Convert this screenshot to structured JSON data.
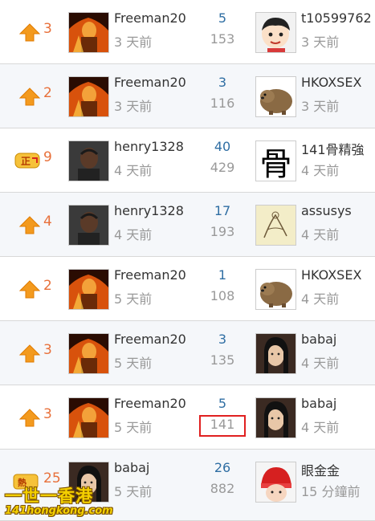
{
  "rows": [
    {
      "badge": "up-arrow-icon",
      "score": "3",
      "author": "Freeman20",
      "author_avatar": "freeman",
      "time": "3 天前",
      "replies": "5",
      "views": "153",
      "last_user": "t10599762",
      "last_avatar": "cartoon",
      "last_time": "3 天前"
    },
    {
      "badge": "up-arrow-icon",
      "score": "2",
      "author": "Freeman20",
      "author_avatar": "freeman",
      "time": "3 天前",
      "replies": "3",
      "views": "116",
      "last_user": "HKOXSEX",
      "last_avatar": "wombat",
      "last_time": "3 天前"
    },
    {
      "badge": "positive-badge-icon",
      "score": "9",
      "author": "henry1328",
      "author_avatar": "henry",
      "time": "4 天前",
      "replies": "40",
      "views": "429",
      "last_user": "141骨精強",
      "last_avatar": "bone-char",
      "last_time": "4 天前"
    },
    {
      "badge": "up-arrow-icon",
      "score": "4",
      "author": "henry1328",
      "author_avatar": "henry",
      "time": "4 天前",
      "replies": "17",
      "views": "193",
      "last_user": "assusys",
      "last_avatar": "sketch",
      "last_time": "4 天前"
    },
    {
      "badge": "up-arrow-icon",
      "score": "2",
      "author": "Freeman20",
      "author_avatar": "freeman",
      "time": "5 天前",
      "replies": "1",
      "views": "108",
      "last_user": "HKOXSEX",
      "last_avatar": "wombat",
      "last_time": "4 天前"
    },
    {
      "badge": "up-arrow-icon",
      "score": "3",
      "author": "Freeman20",
      "author_avatar": "freeman",
      "time": "5 天前",
      "replies": "3",
      "views": "135",
      "last_user": "babaj",
      "last_avatar": "woman",
      "last_time": "4 天前"
    },
    {
      "badge": "up-arrow-icon",
      "score": "3",
      "author": "Freeman20",
      "author_avatar": "freeman",
      "time": "5 天前",
      "replies": "5",
      "views": "141",
      "last_user": "babaj",
      "last_avatar": "woman",
      "last_time": "4 天前",
      "highlight": true
    },
    {
      "badge": "hot-badge-icon",
      "score": "25",
      "author": "babaj",
      "author_avatar": "woman",
      "time": "5 天前",
      "replies": "26",
      "views": "882",
      "last_user": "眼金金",
      "last_avatar": "baby",
      "last_time": "15 分鐘前"
    }
  ],
  "bone_char": "骨",
  "watermark": {
    "title": "一世一香港",
    "url": "141hongkong.com"
  },
  "colors": {
    "score": "#e8703a",
    "replies": "#2f6ea3",
    "muted": "#999999",
    "highlight": "#e02020"
  }
}
